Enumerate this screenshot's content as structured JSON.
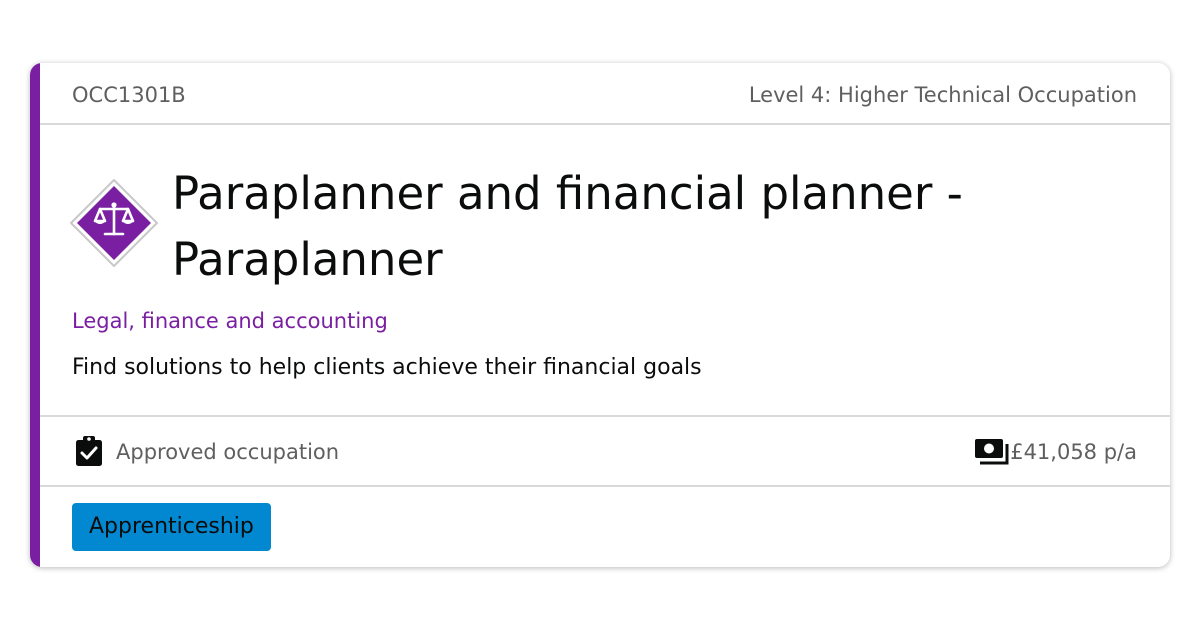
{
  "card": {
    "code": "OCC1301B",
    "level": "Level 4: Higher Technical Occupation",
    "title_line1": "Paraplanner and financial planner -",
    "title_line2": "Paraplanner",
    "route": "Legal, finance and accounting",
    "summary": "Find solutions to help clients achieve their financial goals",
    "status": "Approved occupation",
    "salary": "£41,058 p/a",
    "type_badge": "Apprenticeship",
    "icons": {
      "route": "scales-icon",
      "status": "clipboard-check-icon",
      "salary": "money-notes-icon"
    }
  },
  "colors": {
    "accent": "#7b1fa2",
    "route_text": "#7b1fa2",
    "badge": "#0288d1",
    "muted_text": "#5f5f5f",
    "divider": "#d9d9d9"
  }
}
